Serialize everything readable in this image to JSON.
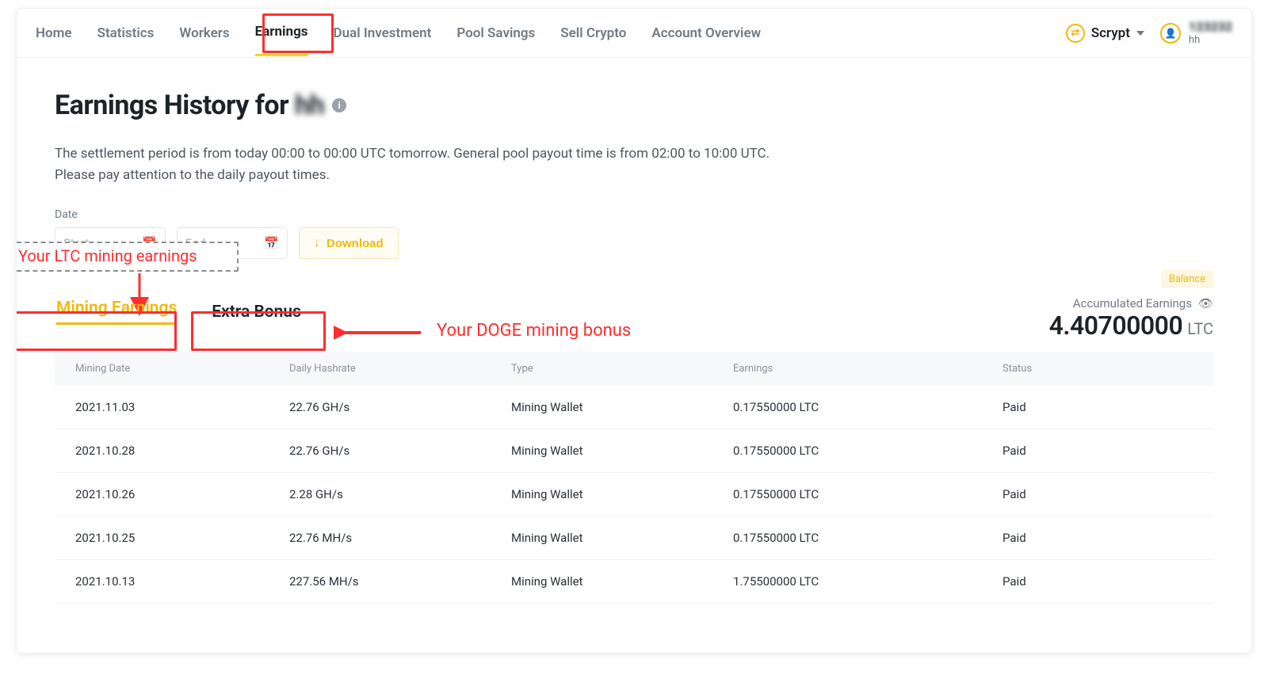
{
  "nav": {
    "items": [
      "Home",
      "Statistics",
      "Workers",
      "Earnings",
      "Dual Investment",
      "Pool Savings",
      "Sell Crypto",
      "Account Overview"
    ],
    "active_index": 3,
    "algo_label": "Scrypt",
    "user_masked": "123232",
    "user_sub": "hh"
  },
  "page": {
    "title_prefix": "Earnings History for ",
    "title_blur": "hh",
    "desc_line1": "The settlement period is from today 00:00 to 00:00 UTC tomorrow. General pool payout time is from 02:00 to 10:00 UTC.",
    "desc_line2": "Please pay attention to the daily payout times.",
    "date_label": "Date",
    "start_placeholder": "Start",
    "end_placeholder": "End",
    "download_label": "Download"
  },
  "annotations": {
    "ltc_box": "Your LTC mining earnings",
    "doge_text": "Your DOGE mining bonus"
  },
  "tabs": {
    "mining": "Mining Earnings",
    "bonus": "Extra Bonus"
  },
  "accum": {
    "pill": "Balance",
    "label": "Accumulated Earnings",
    "value": "4.40700000",
    "unit": "LTC"
  },
  "table": {
    "headers": [
      "Mining Date",
      "Daily Hashrate",
      "Type",
      "Earnings",
      "Status"
    ],
    "rows": [
      {
        "date": "2021.11.03",
        "hash": "22.76 GH/s",
        "type": "Mining Wallet",
        "earn": "0.17550000 LTC",
        "status": "Paid"
      },
      {
        "date": "2021.10.28",
        "hash": "22.76 GH/s",
        "type": "Mining Wallet",
        "earn": "0.17550000 LTC",
        "status": "Paid"
      },
      {
        "date": "2021.10.26",
        "hash": "2.28 GH/s",
        "type": "Mining Wallet",
        "earn": "0.17550000 LTC",
        "status": "Paid"
      },
      {
        "date": "2021.10.25",
        "hash": "22.76 MH/s",
        "type": "Mining Wallet",
        "earn": "0.17550000 LTC",
        "status": "Paid"
      },
      {
        "date": "2021.10.13",
        "hash": "227.56 MH/s",
        "type": "Mining Wallet",
        "earn": "1.75500000 LTC",
        "status": "Paid"
      }
    ]
  }
}
